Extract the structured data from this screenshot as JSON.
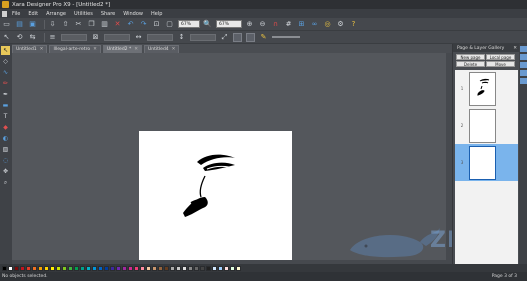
{
  "window": {
    "title": "Xara Designer Pro X9 - [Untitled2 *]"
  },
  "menu": [
    "File",
    "Edit",
    "Arrange",
    "Utilities",
    "Share",
    "Window",
    "Help"
  ],
  "toolbar1": {
    "zoom_combo": "67%",
    "zoom_value": "67%"
  },
  "tabs": [
    {
      "label": "Untitled1",
      "active": false
    },
    {
      "label": "Illegal-arte-retro",
      "active": false
    },
    {
      "label": "Untitled2 *",
      "active": true
    },
    {
      "label": "Untitled4",
      "active": false
    }
  ],
  "gallery": {
    "title": "Page & Layer Gallery",
    "buttons": [
      "New page",
      "Local page",
      "Delete",
      "Move"
    ],
    "rows": [
      {
        "num": "1",
        "selected": false
      },
      {
        "num": "2",
        "selected": false
      },
      {
        "num": "3",
        "selected": true
      }
    ]
  },
  "palette": [
    "#000000",
    "#ffffff",
    "#7a0a0a",
    "#c0141e",
    "#e23c28",
    "#f07020",
    "#f5a000",
    "#ffd200",
    "#fff000",
    "#c8e600",
    "#80c81e",
    "#3cb43c",
    "#00a050",
    "#00a08c",
    "#00b4c8",
    "#0096dc",
    "#0064c8",
    "#003ca0",
    "#3c28a0",
    "#6e28b4",
    "#a028a0",
    "#d22890",
    "#f03c78",
    "#ff8ca0",
    "#f5c8a0",
    "#c8966e",
    "#96643c",
    "#643c1e",
    "#aaaaaa",
    "#c8c8c8",
    "#e0e0e0",
    "#888888",
    "#666666",
    "#444444",
    "#222222",
    "#d0e8ff",
    "#a0d0ff",
    "#ffe0e0",
    "#e0ffe0",
    "#fffbd0"
  ],
  "status": {
    "left": "No objects selected.",
    "right": "Page 3 of 3"
  },
  "watermark": {
    "text": "ZIGG"
  }
}
